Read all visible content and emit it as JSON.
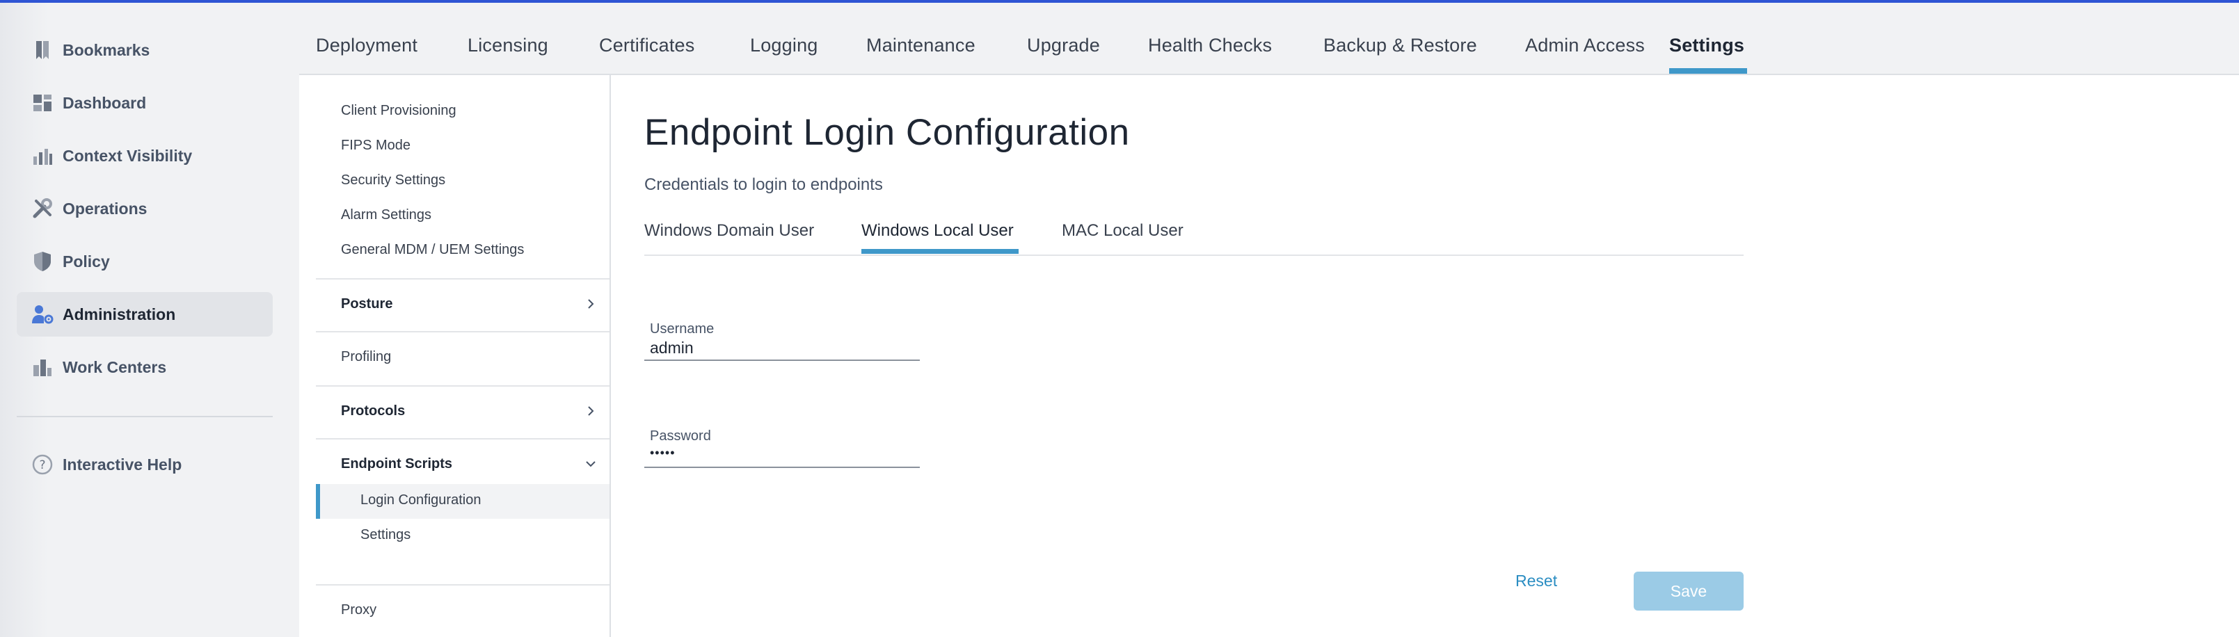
{
  "sidebar": {
    "items": [
      {
        "label": "Bookmarks",
        "icon": "bookmark-icon"
      },
      {
        "label": "Dashboard",
        "icon": "dashboard-icon"
      },
      {
        "label": "Context Visibility",
        "icon": "context-visibility-icon"
      },
      {
        "label": "Operations",
        "icon": "operations-tools-icon"
      },
      {
        "label": "Policy",
        "icon": "policy-shield-icon"
      },
      {
        "label": "Administration",
        "icon": "administration-user-gear-icon",
        "active": true
      },
      {
        "label": "Work Centers",
        "icon": "work-centers-icon"
      }
    ],
    "help": {
      "label": "Interactive Help",
      "icon": "help-circle-icon"
    }
  },
  "top_tabs": {
    "items": [
      "Deployment",
      "Licensing",
      "Certificates",
      "Logging",
      "Maintenance",
      "Upgrade",
      "Health Checks",
      "Backup & Restore",
      "Admin Access",
      "Settings"
    ],
    "active": "Settings"
  },
  "sub_nav": {
    "items": [
      "Client Provisioning",
      "FIPS Mode",
      "Security Settings",
      "Alarm Settings",
      "General MDM / UEM Settings"
    ],
    "posture": "Posture",
    "profiling": "Profiling",
    "protocols": "Protocols",
    "endpoint_scripts": "Endpoint Scripts",
    "endpoint_scripts_children": [
      "Login Configuration",
      "Settings"
    ],
    "proxy": "Proxy"
  },
  "main": {
    "title": "Endpoint Login Configuration",
    "subtitle": "Credentials to login to endpoints",
    "tabs": [
      "Windows Domain User",
      "Windows Local User",
      "MAC Local User"
    ],
    "active_tab": "Windows Local User",
    "username": {
      "label": "Username",
      "value": "admin"
    },
    "password": {
      "label": "Password",
      "value": "•••••"
    },
    "reset_label": "Reset",
    "save_label": "Save"
  },
  "colors": {
    "accent": "#3f98c9",
    "save_disabled": "#9bcbe6",
    "link": "#2b8dc2"
  }
}
